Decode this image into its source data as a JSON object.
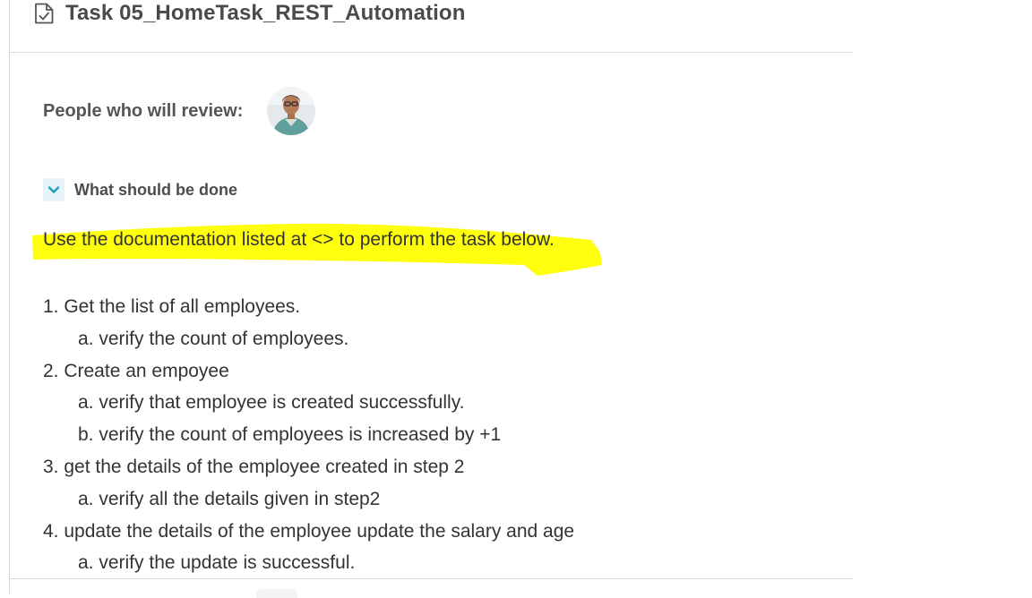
{
  "header": {
    "title": "Task 05_HomeTask_REST_Automation",
    "icon": "document-check-icon"
  },
  "reviewers": {
    "label": "People who will review:",
    "avatar": "reviewer-avatar"
  },
  "section": {
    "title": "What should be done",
    "toggle_icon": "chevron-down-icon",
    "accent": "#1a9fbf",
    "toggle_bg": "#e6f3f7"
  },
  "content": {
    "intro": "Use the documentation listed at <> to perform the task below.",
    "highlight_color": "#ffff00",
    "steps": [
      "1. Get the list of all employees.",
      "a. verify the count of employees.",
      "2. Create an empoyee",
      "a. verify that employee is created successfully.",
      "b. verify the count of employees is increased by +1",
      "3. get the details of the employee created in step 2",
      "a. verify all the details given in step2",
      "4. update the details of the employee update the salary and age",
      "a. verify the update is successful."
    ]
  }
}
